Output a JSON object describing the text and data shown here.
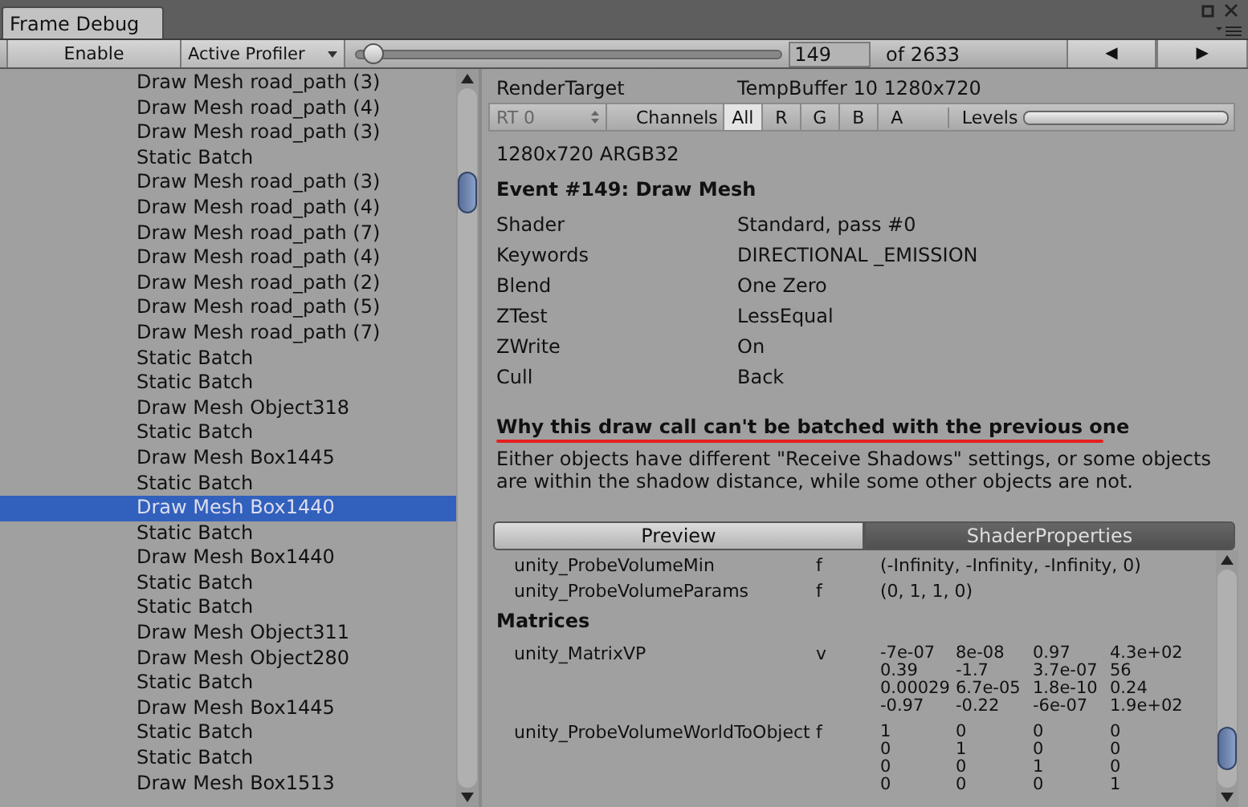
{
  "window": {
    "tab": "Frame Debug"
  },
  "toolbar": {
    "enable": "Enable",
    "profiler": "Active Profiler",
    "event_slider": {
      "level": 0.04
    },
    "event_number": "149",
    "event_total": "of 2633",
    "prev": "◀",
    "next": "▶"
  },
  "events": [
    {
      "label": "Draw Mesh road_path (3)",
      "selected": false
    },
    {
      "label": "Draw Mesh road_path (4)",
      "selected": false
    },
    {
      "label": "Draw Mesh road_path (3)",
      "selected": false
    },
    {
      "label": "Static Batch",
      "selected": false
    },
    {
      "label": "Draw Mesh road_path (3)",
      "selected": false
    },
    {
      "label": "Draw Mesh road_path (4)",
      "selected": false
    },
    {
      "label": "Draw Mesh road_path (7)",
      "selected": false
    },
    {
      "label": "Draw Mesh road_path (4)",
      "selected": false
    },
    {
      "label": "Draw Mesh road_path (2)",
      "selected": false
    },
    {
      "label": "Draw Mesh road_path (5)",
      "selected": false
    },
    {
      "label": "Draw Mesh road_path (7)",
      "selected": false
    },
    {
      "label": "Static Batch",
      "selected": false
    },
    {
      "label": "Static Batch",
      "selected": false
    },
    {
      "label": "Draw Mesh Object318",
      "selected": false
    },
    {
      "label": "Static Batch",
      "selected": false
    },
    {
      "label": "Draw Mesh Box1445",
      "selected": false
    },
    {
      "label": "Static Batch",
      "selected": false
    },
    {
      "label": "Draw Mesh Box1440",
      "selected": true
    },
    {
      "label": "Static Batch",
      "selected": false
    },
    {
      "label": "Draw Mesh Box1440",
      "selected": false
    },
    {
      "label": "Static Batch",
      "selected": false
    },
    {
      "label": "Static Batch",
      "selected": false
    },
    {
      "label": "Draw Mesh Object311",
      "selected": false
    },
    {
      "label": "Draw Mesh Object280",
      "selected": false
    },
    {
      "label": "Static Batch",
      "selected": false
    },
    {
      "label": "Draw Mesh Box1445",
      "selected": false
    },
    {
      "label": "Static Batch",
      "selected": false
    },
    {
      "label": "Static Batch",
      "selected": false
    },
    {
      "label": "Draw Mesh Box1513",
      "selected": false
    }
  ],
  "details": {
    "render_target": {
      "label": "RenderTarget",
      "value": "TempBuffer 10 1280x720"
    },
    "channel_bar": {
      "rt": "RT 0",
      "channels_label": "Channels",
      "channels": [
        {
          "label": "All",
          "selected": true
        },
        {
          "label": "R",
          "selected": false
        },
        {
          "label": "G",
          "selected": false
        },
        {
          "label": "B",
          "selected": false
        },
        {
          "label": "A",
          "selected": false
        }
      ],
      "levels_label": "Levels",
      "levels": {
        "level": 1
      }
    },
    "format": "1280x720 ARGB32",
    "event_title": "Event #149: Draw Mesh",
    "properties": [
      {
        "name": "Shader",
        "value": "Standard, pass #0"
      },
      {
        "name": "Keywords",
        "value": "DIRECTIONAL _EMISSION"
      },
      {
        "name": "Blend",
        "value": "One Zero"
      },
      {
        "name": "ZTest",
        "value": "LessEqual"
      },
      {
        "name": "ZWrite",
        "value": "On"
      },
      {
        "name": "Cull",
        "value": "Back"
      }
    ],
    "batch_heading": "Why this draw call can't be batched with the previous one",
    "batch_reason": "Either objects have different \"Receive Shadows\" settings, or some objects are within the shadow distance, while some other objects are not.",
    "tabs": [
      {
        "label": "Preview",
        "selected": false
      },
      {
        "label": "ShaderProperties",
        "selected": true
      }
    ],
    "shader_properties": [
      {
        "kind": "row",
        "name": "unity_ProbeVolumeMin",
        "type": "f",
        "value": "(-Infinity, -Infinity, -Infinity, 0)"
      },
      {
        "kind": "row",
        "name": "unity_ProbeVolumeParams",
        "type": "f",
        "value": "(0, 1, 1, 0)"
      },
      {
        "kind": "heading",
        "name": "Matrices"
      },
      {
        "kind": "matrix",
        "name": "unity_MatrixVP",
        "type": "v",
        "rows": [
          [
            "-7e-07",
            "8e-08",
            "0.97",
            "4.3e+02"
          ],
          [
            "0.39",
            "-1.7",
            "3.7e-07",
            "56"
          ],
          [
            "0.00029",
            "6.7e-05",
            "1.8e-10",
            "0.24"
          ],
          [
            "-0.97",
            "-0.22",
            "-6e-07",
            "1.9e+02"
          ]
        ]
      },
      {
        "kind": "matrix",
        "name": "unity_ProbeVolumeWorldToObject",
        "type": "f",
        "rows": [
          [
            "1",
            "0",
            "0",
            "0"
          ],
          [
            "0",
            "1",
            "0",
            "0"
          ],
          [
            "0",
            "0",
            "1",
            "0"
          ],
          [
            "0",
            "0",
            "0",
            "1"
          ]
        ]
      }
    ]
  }
}
